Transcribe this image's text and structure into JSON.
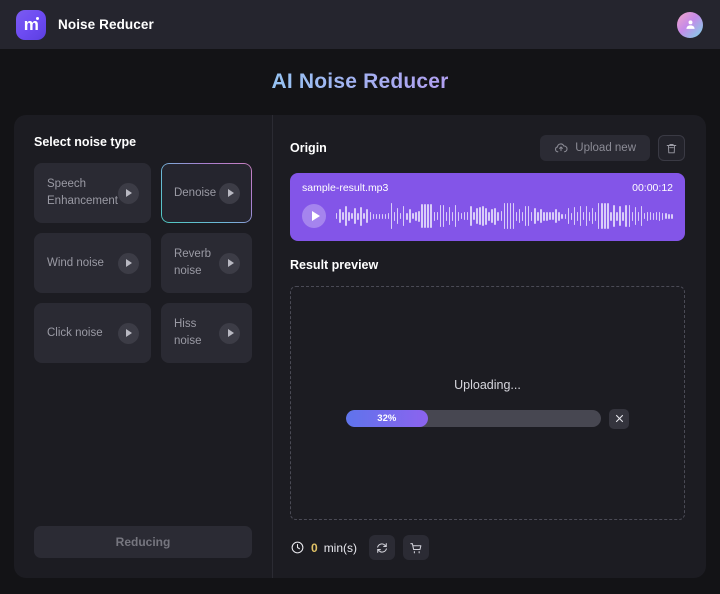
{
  "header": {
    "brand_title": "Noise Reducer",
    "logo_glyph": "m",
    "logo_icon": "app-logo-m",
    "avatar_icon": "user-avatar-icon"
  },
  "page": {
    "title": "AI Noise Reducer"
  },
  "sidebar": {
    "title": "Select noise type",
    "items": [
      {
        "label": "Speech Enhancement",
        "selected": false,
        "play_icon": "play-icon"
      },
      {
        "label": "Denoise",
        "selected": true,
        "play_icon": "play-icon"
      },
      {
        "label": "Wind noise",
        "selected": false,
        "play_icon": "play-icon"
      },
      {
        "label": "Reverb noise",
        "selected": false,
        "play_icon": "play-icon"
      },
      {
        "label": "Click noise",
        "selected": false,
        "play_icon": "play-icon"
      },
      {
        "label": "Hiss noise",
        "selected": false,
        "play_icon": "play-icon"
      }
    ],
    "action_label": "Reducing"
  },
  "origin": {
    "title": "Origin",
    "upload_label": "Upload new",
    "upload_icon": "cloud-upload-icon",
    "delete_icon": "trash-icon",
    "player": {
      "file_name": "sample-result.mp3",
      "duration": "00:00:12",
      "play_icon": "play-icon",
      "waveform": [
        6,
        14,
        8,
        20,
        9,
        6,
        16,
        7,
        19,
        6,
        14,
        8,
        5,
        5,
        5,
        5,
        5,
        6,
        26,
        9,
        16,
        6,
        20,
        7,
        14,
        6,
        9,
        11,
        24,
        24,
        24,
        24,
        9,
        8,
        22,
        22,
        9,
        18,
        9,
        22,
        9,
        6,
        8,
        8,
        20,
        8,
        16,
        18,
        20,
        17,
        9,
        14,
        17,
        9,
        10,
        26,
        26,
        26,
        26,
        9,
        14,
        9,
        20,
        20,
        9,
        16,
        9,
        14,
        9,
        9,
        8,
        8,
        14,
        9,
        5,
        5,
        16,
        7,
        18,
        9,
        20,
        8,
        20,
        9,
        16,
        9,
        26,
        26,
        26,
        26,
        9,
        22,
        9,
        20,
        9,
        22,
        22,
        9,
        18,
        9,
        20,
        6,
        9,
        8,
        7,
        8,
        9,
        7,
        6,
        5,
        5
      ]
    }
  },
  "result": {
    "title": "Result preview",
    "status_text": "Uploading...",
    "progress_percent": "32%",
    "progress_value": 32,
    "cancel_icon": "close-icon"
  },
  "footer": {
    "clock_icon": "clock-icon",
    "time_value": "0",
    "time_unit": "min(s)",
    "refresh_icon": "refresh-icon",
    "cart_icon": "shopping-cart-icon"
  },
  "colors": {
    "accent_purple": "#8355e8",
    "progress_start": "#5f74ec",
    "progress_end": "#8c63ee",
    "time_value": "#e0c266"
  }
}
